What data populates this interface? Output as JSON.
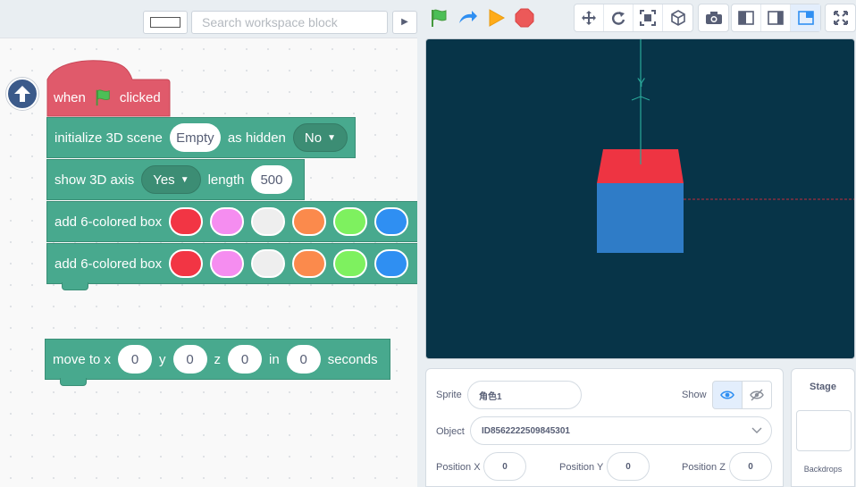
{
  "toolbar": {
    "search_placeholder": "Search workspace block",
    "run_icons": [
      "green-flag-icon",
      "turbo-arrow-icon",
      "play-icon",
      "stop-icon"
    ],
    "tools": [
      "move-icon",
      "redo-icon",
      "fullscreen-frame-icon",
      "3d-cube-icon",
      "camera-icon",
      "layout-left-icon",
      "layout-right-icon",
      "layout-small-stage-icon",
      "expand-icon"
    ]
  },
  "blocks": {
    "hat": {
      "when": "when",
      "clicked": "clicked"
    },
    "init": {
      "label": "initialize 3D scene",
      "scene": "Empty",
      "as_hidden": "as hidden",
      "hidden_value": "No"
    },
    "axis": {
      "label": "show 3D axis",
      "value": "Yes",
      "length_label": "length",
      "length": "500"
    },
    "box1": {
      "label": "add 6-colored box"
    },
    "box2": {
      "label": "add 6-colored box"
    },
    "move": {
      "label": "move to x",
      "x": "0",
      "y_label": "y",
      "y": "0",
      "z_label": "z",
      "z": "0",
      "in_label": "in",
      "seconds": "0",
      "seconds_label": "seconds"
    }
  },
  "box_colors": [
    "#f23544",
    "#f58df0",
    "#eeeeee",
    "#fb8a4c",
    "#7ef15f",
    "#2f8ff2"
  ],
  "stage": {
    "axis_label": "Y",
    "background": "#073448",
    "cube_top": "#ee3442",
    "cube_front": "#2f7cc7"
  },
  "sprite_panel": {
    "sprite_label": "Sprite",
    "sprite_name": "角色1",
    "show_label": "Show",
    "object_label": "Object",
    "object_value": "ID8562222509845301",
    "pos_x_label": "Position X",
    "pos_x": "0",
    "pos_y_label": "Position Y",
    "pos_y": "0",
    "pos_z_label": "Position Z",
    "pos_z": "0"
  },
  "stage_panel": {
    "title": "Stage",
    "backdrops_label": "Backdrops"
  }
}
